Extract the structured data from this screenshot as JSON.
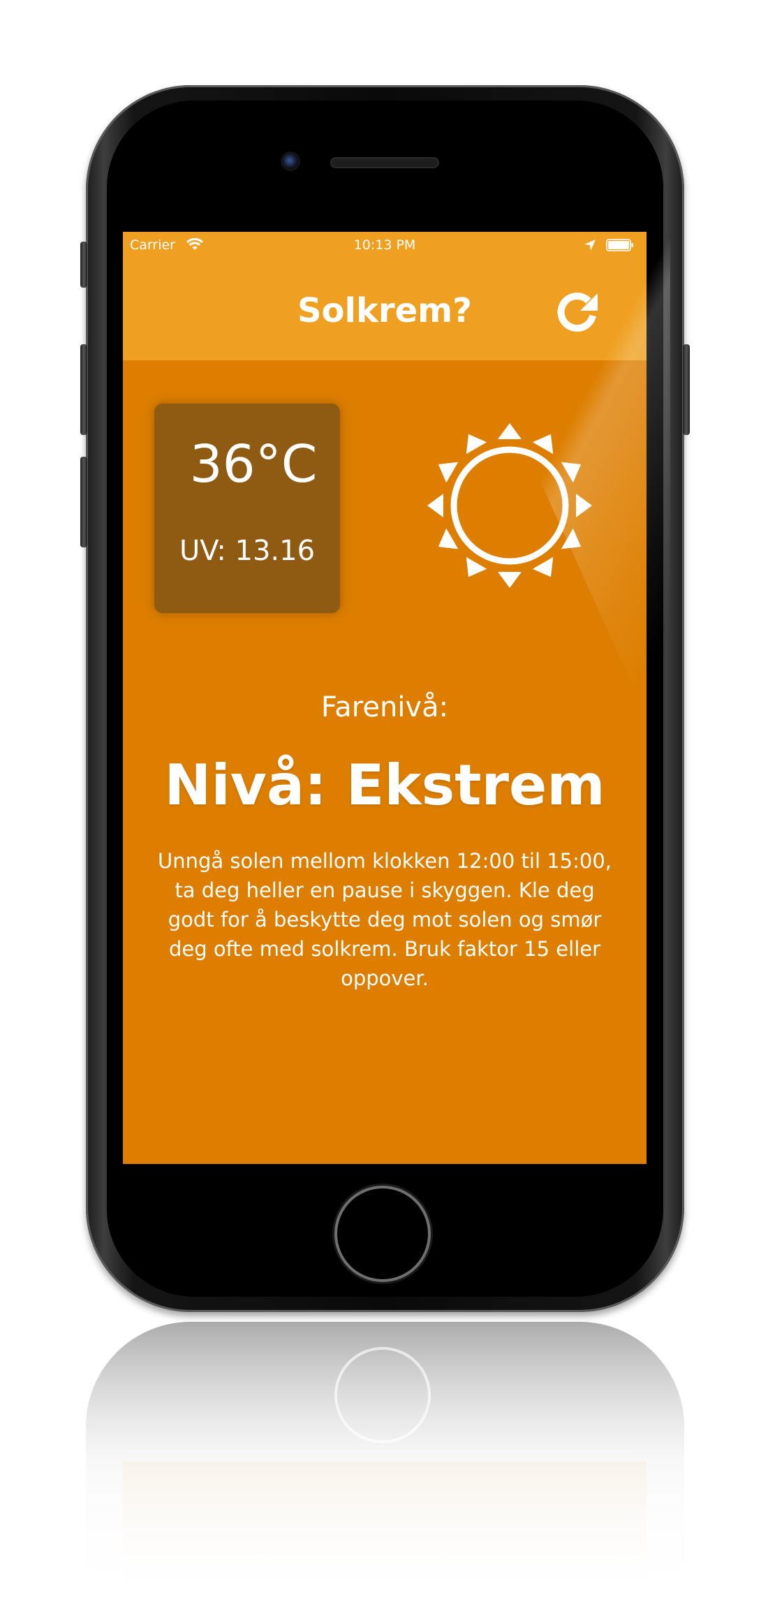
{
  "status_bar": {
    "carrier": "Carrier",
    "time": "10:13 PM",
    "icons": [
      "wifi-icon",
      "location-icon",
      "battery-icon"
    ]
  },
  "nav": {
    "title": "Solkrem?",
    "refresh_icon": "refresh-icon"
  },
  "stats": {
    "temperature": "36°C",
    "uv": "UV: 13.16"
  },
  "weather_icon": "sun-icon",
  "danger": {
    "label": "Farenivå:",
    "level": "Nivå: Ekstrem"
  },
  "advice": "Unngå solen mellom klokken 12:00 til 15:00, ta deg heller en pause i skyggen. Kle deg godt for å beskytte deg mot solen og smør deg ofte med solkrem. Bruk faktor 15 eller oppover.",
  "colors": {
    "background": "#dd7e00",
    "nav_bar": "#efa021",
    "card": "#8f5a12",
    "text": "#ffffff"
  }
}
